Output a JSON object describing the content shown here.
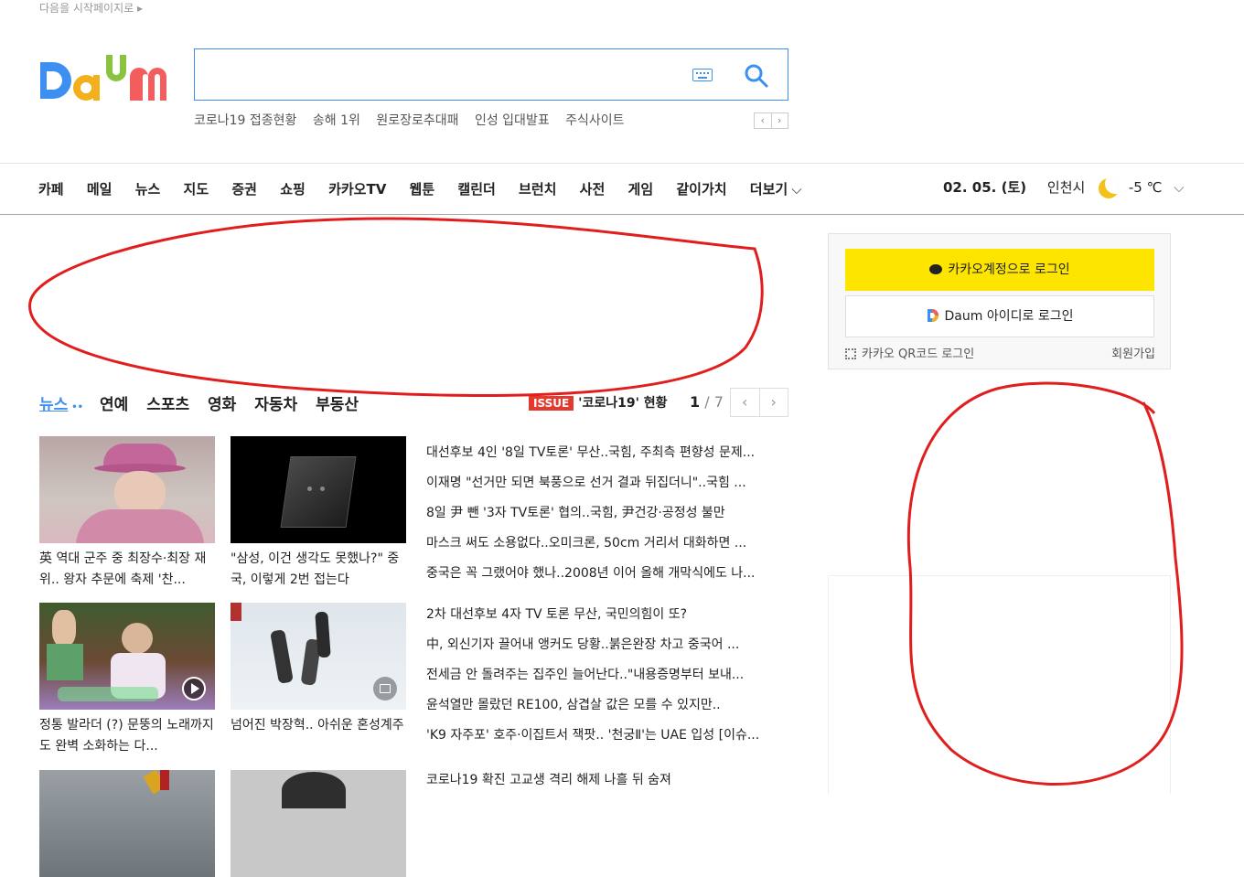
{
  "top": {
    "start_page_label": "다음을 시작페이지로 ▸"
  },
  "logo": {
    "text": "Daum",
    "colors": [
      "#3d8ff2",
      "#f2b01e",
      "#8ac43f",
      "#f25d5d"
    ]
  },
  "search": {
    "value": "",
    "placeholder": ""
  },
  "trending": [
    "코로나19 접종현황",
    "송해 1위",
    "원로장로추대패",
    "인성 입대발표",
    "주식사이트"
  ],
  "trending_nav": {
    "prev": "‹",
    "next": "›"
  },
  "gnb": {
    "menu": [
      "카페",
      "메일",
      "뉴스",
      "지도",
      "증권",
      "쇼핑",
      "카카오TV",
      "웹툰",
      "캘린더",
      "브런치",
      "사전",
      "게임",
      "같이가치"
    ],
    "more_label": "더보기",
    "date": "02. 05. (토)",
    "city": "인천시",
    "temp": "-5 ℃"
  },
  "news": {
    "tabs": [
      "뉴스",
      "연예",
      "스포츠",
      "영화",
      "자동차",
      "부동산"
    ],
    "issue_badge": "ISSUE",
    "issue_text": "'코로나19' 현황",
    "page_current": "1",
    "page_total": " / 7",
    "cards": [
      {
        "text": "英 역대 군주 중 최장수·최장 재위.. 왕자 추문에 축제 '찬..."
      },
      {
        "text": "\"삼성, 이건 생각도 못했나?\" 중국, 이렇게 2번 접는다"
      },
      {
        "text": "정통 발라더 (?) 문뚱의 노래까지도 완벽 소화하는 다..."
      },
      {
        "text": "넘어진 박장혁.. 아쉬운 혼성계주"
      },
      {
        "text": ""
      },
      {
        "text": ""
      }
    ],
    "headlines": [
      "대선후보 4인 '8일 TV토론' 무산..국힘, 주최측 편향성 문제...",
      "이재명 \"선거만 되면 북풍으로 선거 결과 뒤집더니\"..국힘 ...",
      "8일 尹 뺀 '3자 TV토론' 협의..국힘, 尹건강·공정성 불만",
      "마스크 써도 소용없다..오미크론, 50cm 거리서 대화하면 ...",
      "중국은 꼭 그랬어야 했나..2008년 이어 올해 개막식에도 나...",
      "2차 대선후보 4자 TV 토론 무산, 국민의힘이 또?",
      "中, 외신기자 끌어내 앵커도 당황..붉은완장 차고 중국어 ...",
      "전세금 안 돌려주는 집주인 늘어난다..\"내용증명부터 보내...",
      "윤석열만 몰랐던 RE100, 삼겹살 값은 모를 수 있지만..",
      "'K9 자주포' 호주·이집트서 잭팟.. '천궁Ⅱ'는 UAE 입성 [이슈...",
      "코로나19 확진 고교생 격리 해제 나흘 뒤 숨져"
    ]
  },
  "login": {
    "kakao_label": "카카오계정으로 로그인",
    "daum_label": "Daum 아이디로 로그인",
    "qr_label": "카카오 QR코드 로그인",
    "join_label": "회원가입"
  },
  "annotation_color": "#e01e1e"
}
